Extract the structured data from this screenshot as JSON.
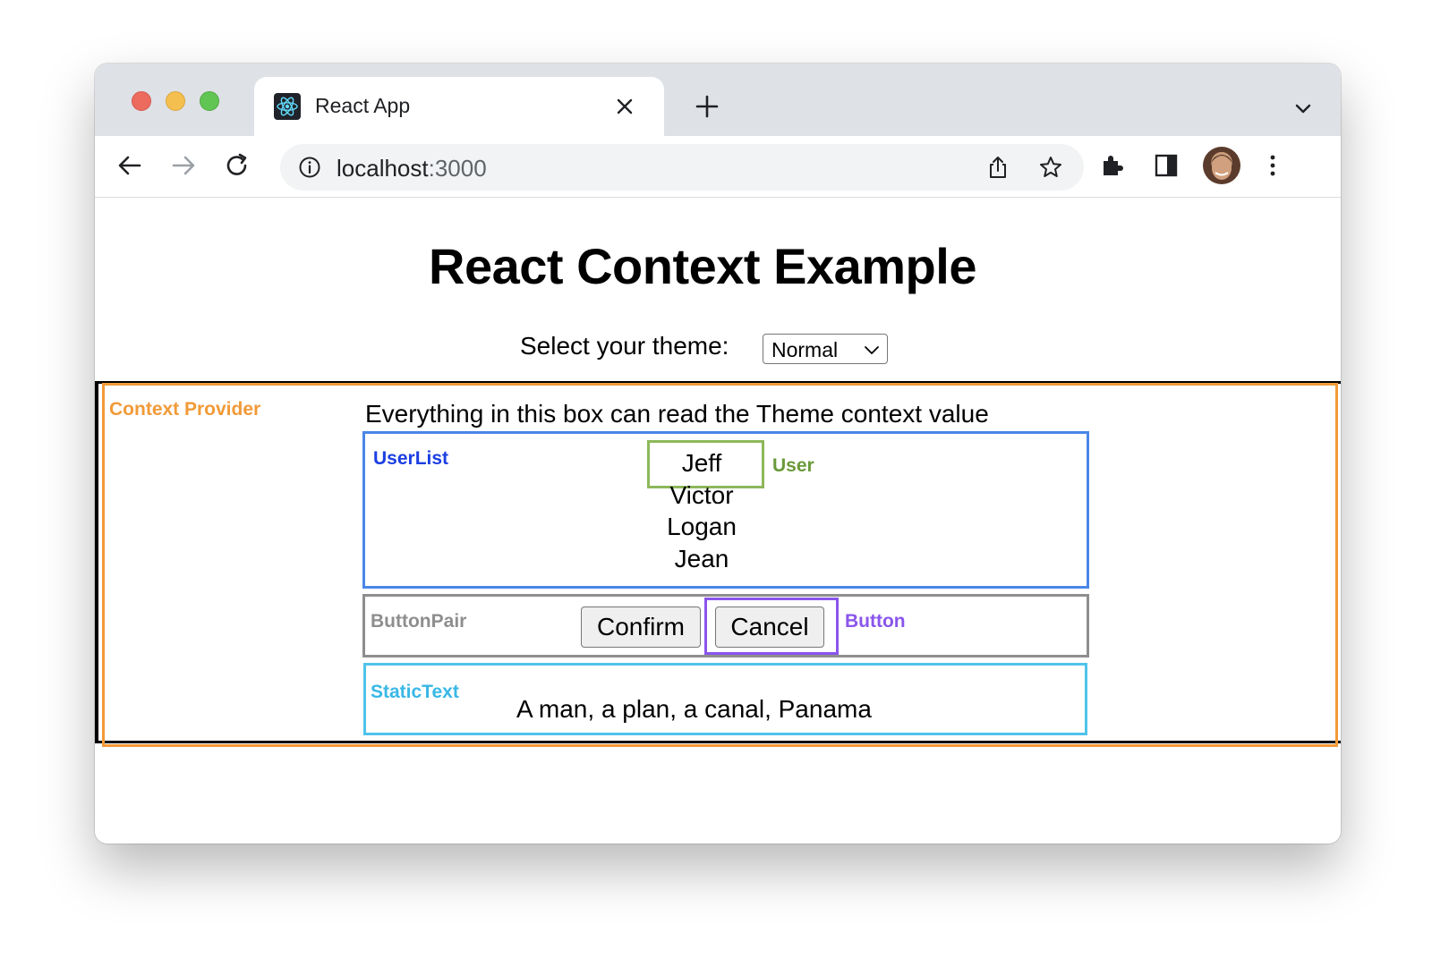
{
  "browser": {
    "tab_title": "React App",
    "url_host": "localhost",
    "url_port": ":3000"
  },
  "page": {
    "title": "React Context Example",
    "theme_label": "Select your theme:",
    "theme_selected": "Normal"
  },
  "provider": {
    "label": "Context Provider",
    "description": "Everything in this box can read the Theme context value"
  },
  "userlist": {
    "label": "UserList",
    "user_label": "User",
    "users": [
      "Jeff",
      "Victor",
      "Logan",
      "Jean"
    ]
  },
  "buttonpair": {
    "label": "ButtonPair",
    "button_label": "Button",
    "confirm": "Confirm",
    "cancel": "Cancel"
  },
  "statictext": {
    "label": "StaticText",
    "text": "A man, a plan, a canal, Panama"
  },
  "colors": {
    "provider": "#f19a38",
    "userlist": "#4a86e8",
    "user": "#8db85a",
    "buttonpair": "#8e8e8e",
    "button": "#8a55ec",
    "statictext": "#4fc3ea"
  }
}
